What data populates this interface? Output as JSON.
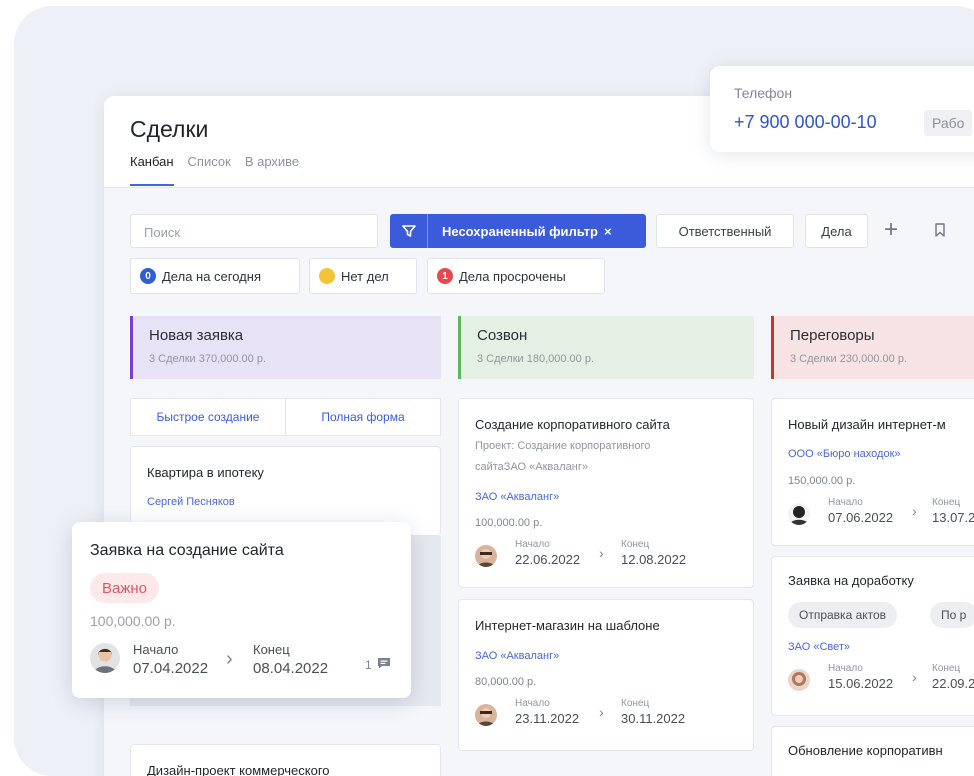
{
  "page": {
    "title": "Сделки",
    "tabs": [
      {
        "label": "Канбан",
        "active": true
      },
      {
        "label": "Список",
        "active": false
      },
      {
        "label": "В архиве",
        "active": false
      }
    ]
  },
  "toolbar": {
    "search_placeholder": "Поиск",
    "filter_label": "Несохраненный фильтр",
    "filter_close": "×",
    "responsible_label": "Ответственный",
    "tasks_label": "Дела",
    "add_icon": "+",
    "icons": [
      "filter-icon",
      "plus-icon",
      "bookmark-icon"
    ]
  },
  "chips": [
    {
      "count": "0",
      "label": "Дела на сегодня",
      "color": "#2f5fd0"
    },
    {
      "count": "",
      "label": "Нет дел",
      "color": "#f3c33a"
    },
    {
      "count": "1",
      "label": "Дела просрочены",
      "color": "#e5484d"
    }
  ],
  "columns": [
    {
      "name": "Новая заявка",
      "summary": "3 Сделки  370,000.00 р.",
      "bg": "#e8e2f7",
      "accent": "#7b3fd0"
    },
    {
      "name": "Созвон",
      "summary": "3 Сделки  180,000.00 р.",
      "bg": "#e4f0e4",
      "accent": "#5cb85c"
    },
    {
      "name": "Переговоры",
      "summary": "3 Сделки  230,000.00 р.",
      "bg": "#f7e3e4",
      "accent": "#c0392b"
    }
  ],
  "quick_create": {
    "left": "Быстрое создание",
    "right": "Полная форма"
  },
  "cards": {
    "c1": {
      "title": "Квартира в ипотеку",
      "person": "Сергей Песняков"
    },
    "c1b": {
      "title": "Дизайн-проект коммерческого"
    },
    "c2": {
      "title": "Создание корпоративного сайта",
      "project_line1": "Проект: Создание корпоративного",
      "project_line2": "сайтаЗАО «Акваланг»",
      "company": "ЗАО «Акваланг»",
      "amount": "100,000.00 р.",
      "start_label": "Начало",
      "start": "22.06.2022",
      "end_label": "Конец",
      "end": "12.08.2022"
    },
    "c3": {
      "title": "Интернет-магазин на шаблоне",
      "company": "ЗАО «Акваланг»",
      "amount": "80,000.00 р.",
      "start_label": "Начало",
      "start": "23.11.2022",
      "end_label": "Конец",
      "end": "30.11.2022"
    },
    "c4": {
      "title": "Новый дизайн интернет-м",
      "company": "ООО «Бюро находок»",
      "amount": "150,000.00 р.",
      "start_label": "Начало",
      "start": "07.06.2022",
      "end_label": "Конец",
      "end": "13.07.2"
    },
    "c5": {
      "title": "Заявка на доработку",
      "tag1": "Отправка актов",
      "tag2": "По р",
      "company": "ЗАО «Свет»",
      "start_label": "Начало",
      "start": "15.06.2022",
      "end_label": "Конец",
      "end": "22.09.2"
    },
    "c6": {
      "title": "Обновление корпоративн"
    }
  },
  "phone": {
    "label": "Телефон",
    "number": "+7 900 000-00-10",
    "tag": "Рабо"
  },
  "floating_card": {
    "title": "Заявка на создание сайта",
    "badge": "Важно",
    "amount": "100,000.00 р.",
    "start_label": "Начало",
    "start": "07.04.2022",
    "end_label": "Конец",
    "end": "08.04.2022",
    "comments": "1"
  }
}
